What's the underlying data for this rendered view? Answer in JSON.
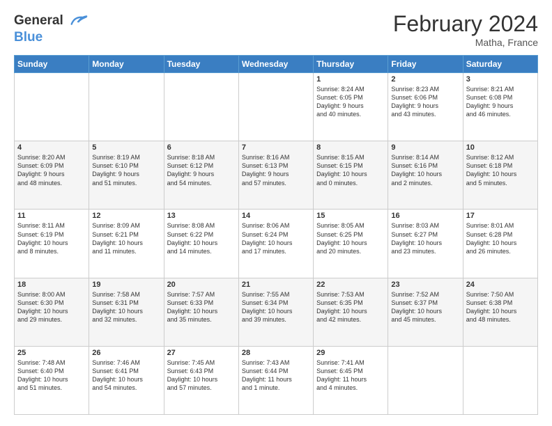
{
  "header": {
    "logo_line1": "General",
    "logo_line2": "Blue",
    "month_title": "February 2024",
    "location": "Matha, France"
  },
  "days_of_week": [
    "Sunday",
    "Monday",
    "Tuesday",
    "Wednesday",
    "Thursday",
    "Friday",
    "Saturday"
  ],
  "weeks": [
    [
      {
        "num": "",
        "info": ""
      },
      {
        "num": "",
        "info": ""
      },
      {
        "num": "",
        "info": ""
      },
      {
        "num": "",
        "info": ""
      },
      {
        "num": "1",
        "info": "Sunrise: 8:24 AM\nSunset: 6:05 PM\nDaylight: 9 hours\nand 40 minutes."
      },
      {
        "num": "2",
        "info": "Sunrise: 8:23 AM\nSunset: 6:06 PM\nDaylight: 9 hours\nand 43 minutes."
      },
      {
        "num": "3",
        "info": "Sunrise: 8:21 AM\nSunset: 6:08 PM\nDaylight: 9 hours\nand 46 minutes."
      }
    ],
    [
      {
        "num": "4",
        "info": "Sunrise: 8:20 AM\nSunset: 6:09 PM\nDaylight: 9 hours\nand 48 minutes."
      },
      {
        "num": "5",
        "info": "Sunrise: 8:19 AM\nSunset: 6:10 PM\nDaylight: 9 hours\nand 51 minutes."
      },
      {
        "num": "6",
        "info": "Sunrise: 8:18 AM\nSunset: 6:12 PM\nDaylight: 9 hours\nand 54 minutes."
      },
      {
        "num": "7",
        "info": "Sunrise: 8:16 AM\nSunset: 6:13 PM\nDaylight: 9 hours\nand 57 minutes."
      },
      {
        "num": "8",
        "info": "Sunrise: 8:15 AM\nSunset: 6:15 PM\nDaylight: 10 hours\nand 0 minutes."
      },
      {
        "num": "9",
        "info": "Sunrise: 8:14 AM\nSunset: 6:16 PM\nDaylight: 10 hours\nand 2 minutes."
      },
      {
        "num": "10",
        "info": "Sunrise: 8:12 AM\nSunset: 6:18 PM\nDaylight: 10 hours\nand 5 minutes."
      }
    ],
    [
      {
        "num": "11",
        "info": "Sunrise: 8:11 AM\nSunset: 6:19 PM\nDaylight: 10 hours\nand 8 minutes."
      },
      {
        "num": "12",
        "info": "Sunrise: 8:09 AM\nSunset: 6:21 PM\nDaylight: 10 hours\nand 11 minutes."
      },
      {
        "num": "13",
        "info": "Sunrise: 8:08 AM\nSunset: 6:22 PM\nDaylight: 10 hours\nand 14 minutes."
      },
      {
        "num": "14",
        "info": "Sunrise: 8:06 AM\nSunset: 6:24 PM\nDaylight: 10 hours\nand 17 minutes."
      },
      {
        "num": "15",
        "info": "Sunrise: 8:05 AM\nSunset: 6:25 PM\nDaylight: 10 hours\nand 20 minutes."
      },
      {
        "num": "16",
        "info": "Sunrise: 8:03 AM\nSunset: 6:27 PM\nDaylight: 10 hours\nand 23 minutes."
      },
      {
        "num": "17",
        "info": "Sunrise: 8:01 AM\nSunset: 6:28 PM\nDaylight: 10 hours\nand 26 minutes."
      }
    ],
    [
      {
        "num": "18",
        "info": "Sunrise: 8:00 AM\nSunset: 6:30 PM\nDaylight: 10 hours\nand 29 minutes."
      },
      {
        "num": "19",
        "info": "Sunrise: 7:58 AM\nSunset: 6:31 PM\nDaylight: 10 hours\nand 32 minutes."
      },
      {
        "num": "20",
        "info": "Sunrise: 7:57 AM\nSunset: 6:33 PM\nDaylight: 10 hours\nand 35 minutes."
      },
      {
        "num": "21",
        "info": "Sunrise: 7:55 AM\nSunset: 6:34 PM\nDaylight: 10 hours\nand 39 minutes."
      },
      {
        "num": "22",
        "info": "Sunrise: 7:53 AM\nSunset: 6:35 PM\nDaylight: 10 hours\nand 42 minutes."
      },
      {
        "num": "23",
        "info": "Sunrise: 7:52 AM\nSunset: 6:37 PM\nDaylight: 10 hours\nand 45 minutes."
      },
      {
        "num": "24",
        "info": "Sunrise: 7:50 AM\nSunset: 6:38 PM\nDaylight: 10 hours\nand 48 minutes."
      }
    ],
    [
      {
        "num": "25",
        "info": "Sunrise: 7:48 AM\nSunset: 6:40 PM\nDaylight: 10 hours\nand 51 minutes."
      },
      {
        "num": "26",
        "info": "Sunrise: 7:46 AM\nSunset: 6:41 PM\nDaylight: 10 hours\nand 54 minutes."
      },
      {
        "num": "27",
        "info": "Sunrise: 7:45 AM\nSunset: 6:43 PM\nDaylight: 10 hours\nand 57 minutes."
      },
      {
        "num": "28",
        "info": "Sunrise: 7:43 AM\nSunset: 6:44 PM\nDaylight: 11 hours\nand 1 minute."
      },
      {
        "num": "29",
        "info": "Sunrise: 7:41 AM\nSunset: 6:45 PM\nDaylight: 11 hours\nand 4 minutes."
      },
      {
        "num": "",
        "info": ""
      },
      {
        "num": "",
        "info": ""
      }
    ]
  ]
}
